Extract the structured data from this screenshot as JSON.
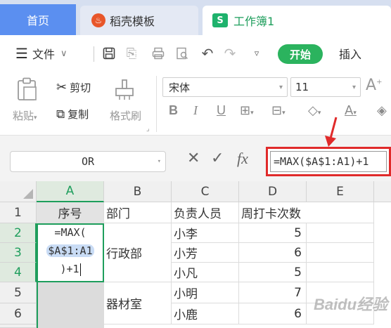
{
  "tabs": {
    "home": "首页",
    "daoke": "稻壳模板",
    "workbook": "工作簿1",
    "workbook_logo": "S"
  },
  "menu": {
    "file": "文件",
    "start": "开始",
    "insert": "插入"
  },
  "ribbon": {
    "paste": "粘贴",
    "cut": "剪切",
    "copy": "复制",
    "format_painter": "格式刷",
    "font_name": "宋体",
    "font_size": "11",
    "bold": "B",
    "italic": "I",
    "underline": "U"
  },
  "formula_bar": {
    "name_box": "OR",
    "fx_label": "fx",
    "formula": "=MAX($A$1:A1)+1"
  },
  "columns": [
    "A",
    "B",
    "C",
    "D",
    "E"
  ],
  "rows": [
    "1",
    "2",
    "3",
    "4",
    "5",
    "6"
  ],
  "headers": {
    "a1": "序号",
    "b1": "部门",
    "c1": "负责人员",
    "d1": "周打卡次数"
  },
  "editing_cell": {
    "line1": "=MAX(",
    "line2": "$A$1:A1",
    "line3": ")+1"
  },
  "departments": {
    "admin": "行政部",
    "equipment": "器材室"
  },
  "records": [
    {
      "name": "小李",
      "count": "5"
    },
    {
      "name": "小芳",
      "count": "6"
    },
    {
      "name": "小凡",
      "count": "5"
    },
    {
      "name": "小明",
      "count": "7"
    },
    {
      "name": "小鹿",
      "count": "6"
    }
  ],
  "watermark": "Baidu经验"
}
